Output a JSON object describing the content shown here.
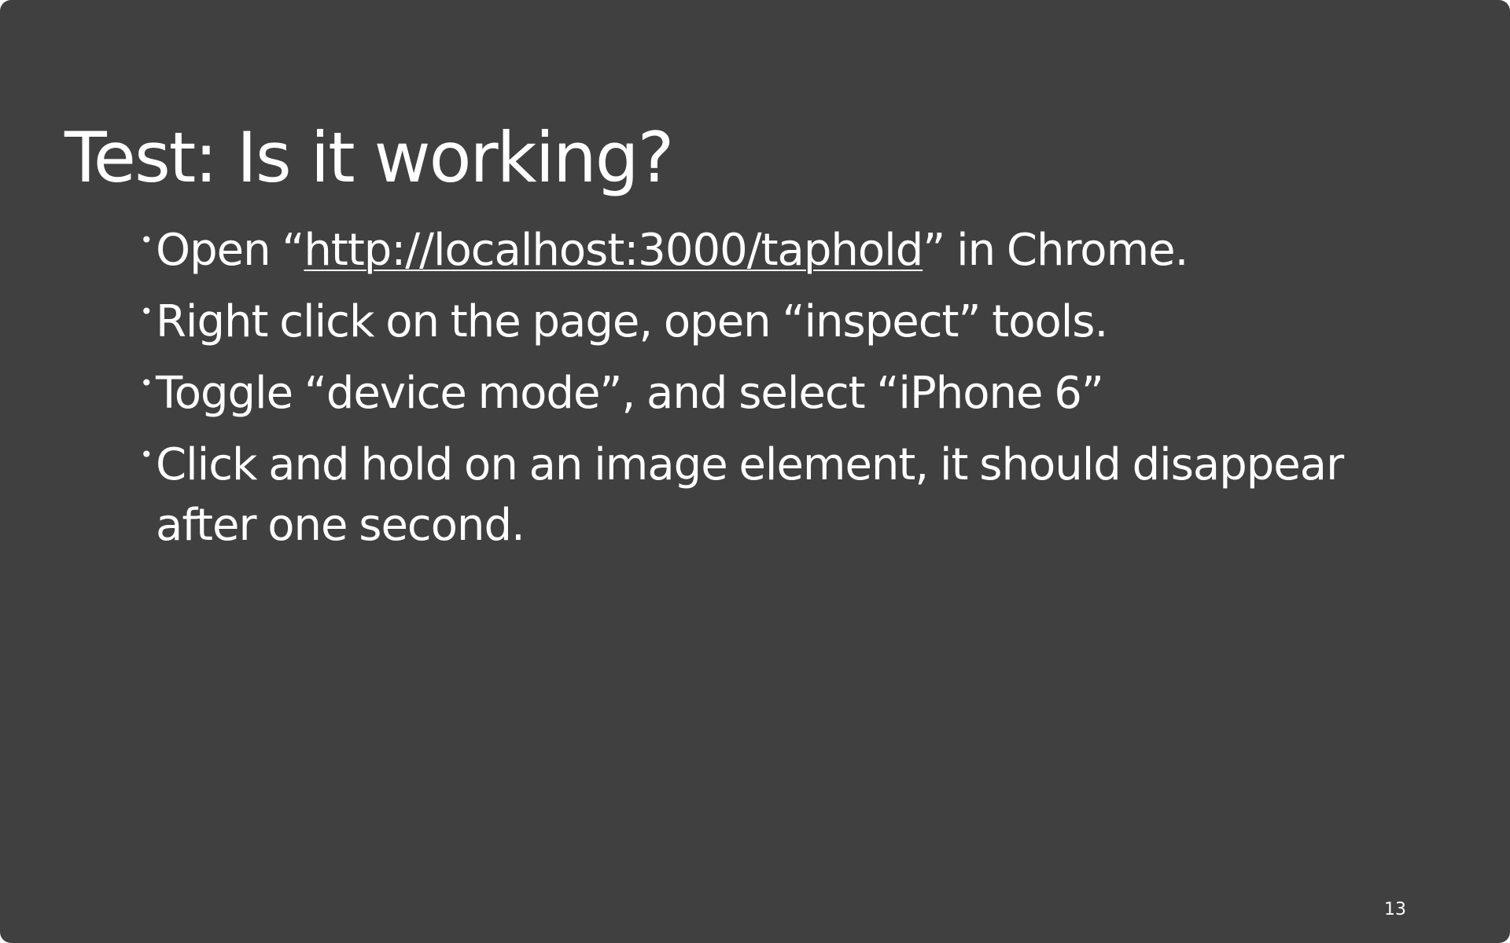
{
  "slide": {
    "title": "Test: Is it working?",
    "bullet_marker": "•",
    "bullets": [
      {
        "before": "Open “",
        "link": "http://localhost:3000/taphold",
        "after": "” in Chrome."
      },
      {
        "text": "Right click on the page, open “inspect” tools."
      },
      {
        "text": "Toggle “device mode”, and select “iPhone 6”"
      },
      {
        "text": "Click and hold on an image element, it should disappear after one second."
      }
    ],
    "page_number": "13"
  },
  "colors": {
    "background": "#404040",
    "text": "#ffffff"
  }
}
